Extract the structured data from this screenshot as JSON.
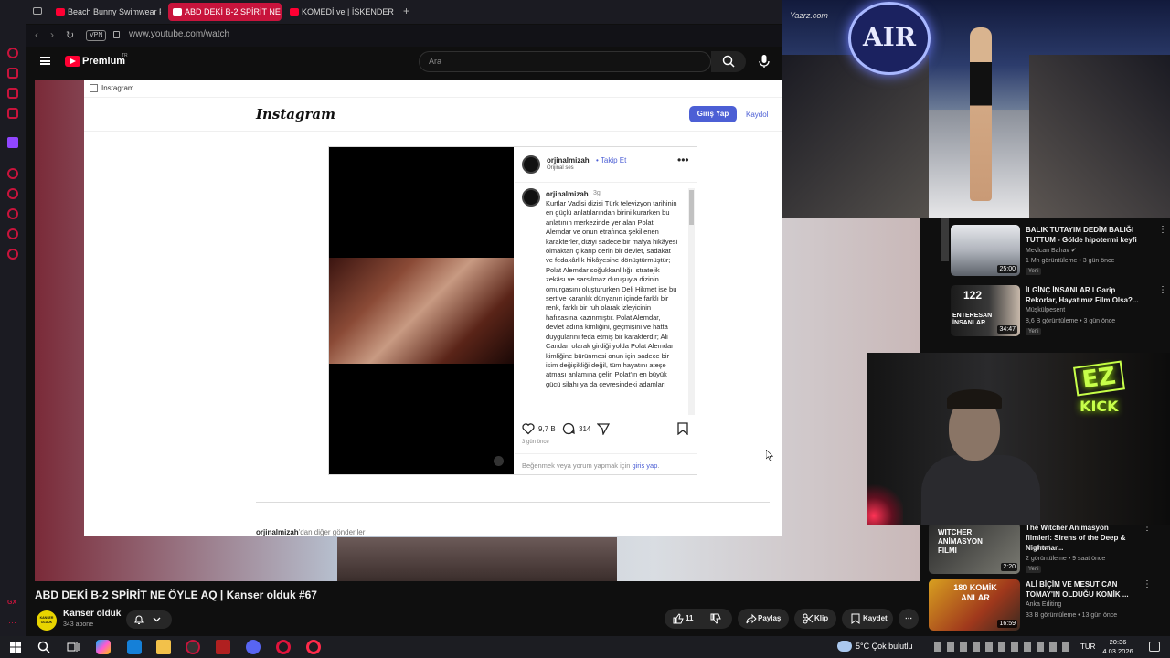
{
  "browser": {
    "tabs": [
      {
        "label": "Beach Bunny Swimwear F"
      },
      {
        "label": "ABD DEKİ B-2 SPİRİT NE Ö"
      },
      {
        "label": "KOMEDİ ve | İSKENDER -"
      }
    ],
    "new_tab": "+",
    "vpn": "VPN",
    "url": "www.youtube.com/watch"
  },
  "youtube": {
    "brand": "Premium",
    "brand_sup": "TR",
    "search_placeholder": "Ara",
    "video_title": "ABD DEKİ B-2 SPİRİT NE ÖYLE AQ | Kanser olduk #67",
    "channel_avatar_text": "KANSER OLDUK",
    "channel_name": "Kanser olduk",
    "channel_subs": "343 abone",
    "likes": "11",
    "share": "Paylaş",
    "clip": "Klip",
    "save": "Kaydet",
    "more": "⋯"
  },
  "instagram": {
    "window_title": "Instagram",
    "logo": "Instagram",
    "login": "Giriş Yap",
    "signup": "Kaydol",
    "username": "orjinalmizah",
    "follow": "• Takip Et",
    "audio": "Orijinal ses",
    "comment_user": "orjinalmizah",
    "comment_time": "3g",
    "caption": "Kurtlar Vadisi dizisi Türk televizyon tarihinin en güçlü anlatılarından birini kurarken bu anlatının merkezinde yer alan Polat Alemdar ve onun etrafında şekillenen karakterler, diziyi sadece bir mafya hikâyesi olmaktan çıkarıp derin bir devlet, sadakat ve fedakârlık hikâyesine dönüştürmüştür; Polat Alemdar soğukkanlılığı, stratejik zekâsı ve sarsılmaz duruşuyla dizinin omurgasını oluştururken Deli Hikmet ise bu sert ve karanlık dünyanın içinde farklı bir renk, farklı bir ruh olarak izleyicinin hafızasına kazınmıştır. Polat Alemdar, devlet adına kimliğini, geçmişini ve hatta duygularını feda etmiş bir karakterdir; Ali Candan olarak girdiği yolda Polat Alemdar kimliğine bürünmesi onun için sadece bir isim değişikliği değil, tüm hayatını ateşe atması anlamına gelir. Polat'ın en büyük gücü silahı ya da çevresindeki adamları",
    "likes": "9,7 B",
    "comments": "314",
    "date": "3 gün önce",
    "comment_prompt": "Beğenmek veya yorum yapmak için ",
    "comment_link": "giriş yap",
    "comment_end": ".",
    "more_posts_user": "orjinalmizah",
    "more_posts_suffix": "'dan diğer gönderiler"
  },
  "runway": {
    "logo": "AIR",
    "watermark": "Yazrz.com"
  },
  "webcam": {
    "sign_top": "EZ",
    "sign_bottom": "KICK"
  },
  "recommendations": [
    {
      "title": "BALIK TUTAYIM DEDİM BALIĞI TUTTUM - Gölde hipotermi keyfi",
      "channel": "Mevlcan Bahav ✔",
      "meta": "1 Mn görüntüleme • 3 gün önce",
      "badge": "Yeni",
      "duration": "25:00"
    },
    {
      "title": "İLGİNÇ İNSANLAR I Garip Rekorlar, Hayatımız Film Olsa?...",
      "channel": "Müşkülpesent",
      "meta": "8,6 B görüntüleme • 3 gün önce",
      "badge": "Yeni",
      "duration": "34:47",
      "thumb_text": "ENTERESAN İNSANLAR",
      "thumb_num": "122"
    },
    {
      "title": "The Witcher Animasyon filmleri: Sirens of the Deep & Nightmar...",
      "channel": "Murtimet",
      "meta": "2 görüntüleme • 9 saat önce",
      "badge": "Yeni",
      "duration": "2:20",
      "thumb_text": "WITCHER ANİMASYON FİLMİ"
    },
    {
      "title": "ALİ BİÇİM VE MESUT CAN TOMAY'IN OLDUĞU KOMİK ...",
      "channel": "Anka Editing",
      "meta": "33 B görüntüleme • 13 gün önce",
      "badge": "",
      "duration": "16:59",
      "thumb_text": "180 KOMİK ANLAR"
    }
  ],
  "taskbar": {
    "weather": "5°C  Çok bulutlu",
    "lang": "TUR",
    "time": "20:36",
    "date": "4.03.2026"
  }
}
